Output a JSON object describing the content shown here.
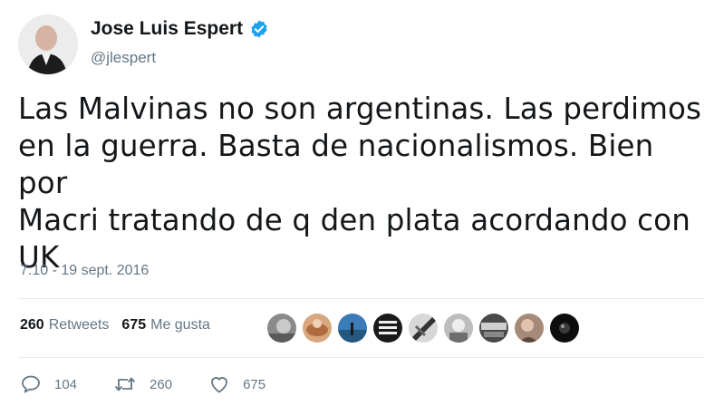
{
  "author": {
    "name": "Jose Luis Espert",
    "handle": "@jlespert",
    "verified": true
  },
  "tweet": {
    "lines": [
      "Las Malvinas no son argentinas. Las perdimos",
      "en la guerra. Basta de nacionalismos. Bien por",
      "Macri tratando de q den plata acordando con",
      "UK"
    ],
    "timestamp": "7:10 - 19 sept. 2016"
  },
  "stats": {
    "retweets_count": "260",
    "retweets_label": "Retweets",
    "likes_count": "675",
    "likes_label": "Me gusta"
  },
  "likers_count": 9,
  "actions": {
    "reply_count": "104",
    "retweet_count": "260",
    "like_count": "675"
  },
  "colors": {
    "verified_blue": "#1da1f2",
    "secondary_text": "#657786",
    "primary_text": "#14171a",
    "divider": "#e6ecf0"
  }
}
